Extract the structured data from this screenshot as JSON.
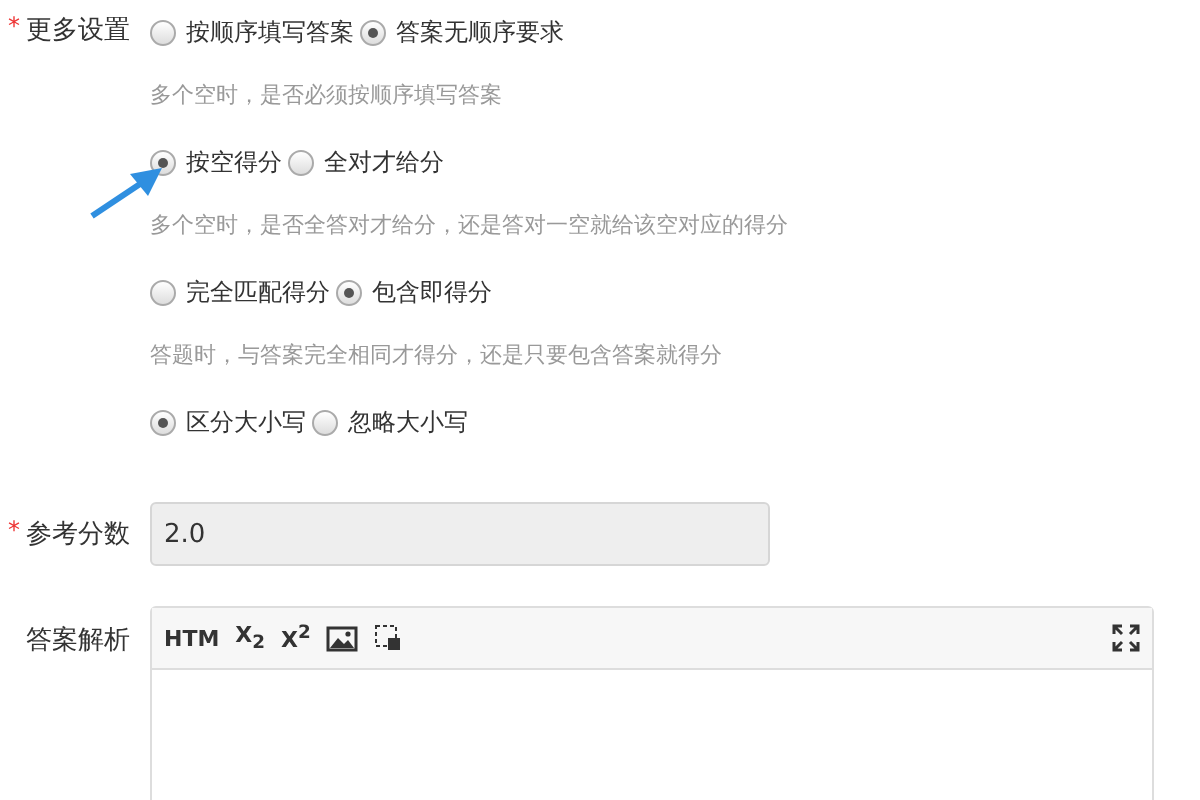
{
  "more_settings": {
    "label": "更多设置",
    "required_mark": "*",
    "groups": [
      {
        "options": [
          {
            "label": "按顺序填写答案",
            "selected": false
          },
          {
            "label": "答案无顺序要求",
            "selected": true
          }
        ],
        "hint": "多个空时，是否必须按顺序填写答案"
      },
      {
        "options": [
          {
            "label": "按空得分",
            "selected": true
          },
          {
            "label": "全对才给分",
            "selected": false
          }
        ],
        "hint": "多个空时，是否全答对才给分，还是答对一空就给该空对应的得分"
      },
      {
        "options": [
          {
            "label": "完全匹配得分",
            "selected": false
          },
          {
            "label": "包含即得分",
            "selected": true
          }
        ],
        "hint": "答题时，与答案完全相同才得分，还是只要包含答案就得分"
      },
      {
        "options": [
          {
            "label": "区分大小写",
            "selected": true
          },
          {
            "label": "忽略大小写",
            "selected": false
          }
        ]
      }
    ]
  },
  "score": {
    "label": "参考分数",
    "required_mark": "*",
    "value": "2.0",
    "disabled": true
  },
  "analysis": {
    "label": "答案解析",
    "toolbar": [
      {
        "kind": "text",
        "text": "HTM"
      },
      {
        "kind": "text",
        "text": "X$_{2}$"
      },
      {
        "kind": "text",
        "text": "X$^{2}$"
      },
      {
        "kind": "image"
      },
      {
        "kind": "select"
      },
      {
        "kind": "fullscreen"
      }
    ]
  }
}
